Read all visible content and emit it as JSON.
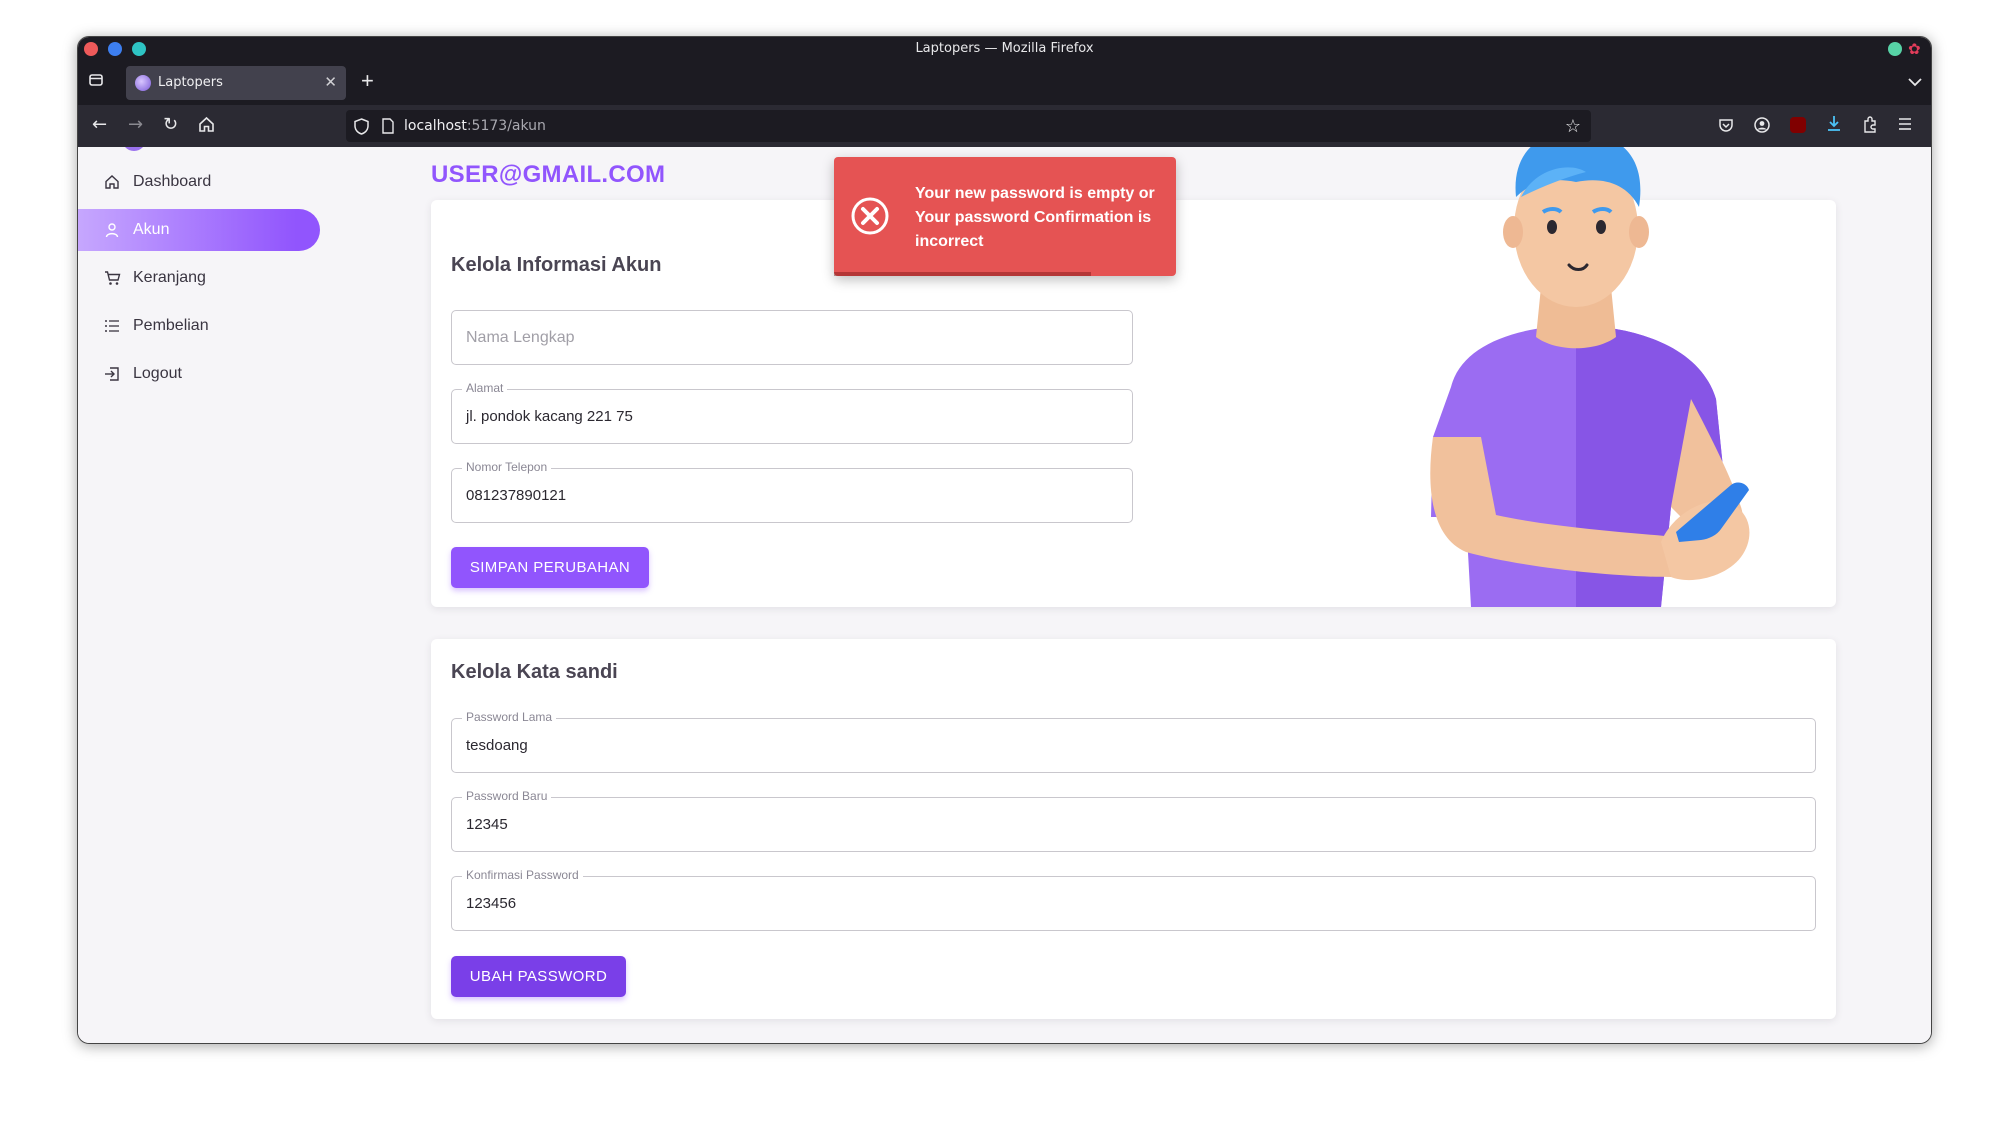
{
  "browser": {
    "window_title": "Laptopers — Mozilla Firefox",
    "tab_title": "Laptopers",
    "url_host": "localhost",
    "url_rest": ":5173/akun"
  },
  "sidebar": {
    "items": [
      {
        "label": "Dashboard",
        "icon": "home-icon"
      },
      {
        "label": "Akun",
        "icon": "user-icon",
        "active": true
      },
      {
        "label": "Keranjang",
        "icon": "cart-icon"
      },
      {
        "label": "Pembelian",
        "icon": "list-icon"
      },
      {
        "label": "Logout",
        "icon": "logout-icon"
      }
    ]
  },
  "header": {
    "email": "USER@GMAIL.COM"
  },
  "account_card": {
    "title": "Kelola Informasi Akun",
    "name_placeholder": "Nama Lengkap",
    "address_label": "Alamat",
    "address_value": "jl. pondok kacang 221 75",
    "phone_label": "Nomor Telepon",
    "phone_value": "081237890121",
    "save_button": "SIMPAN PERUBAHAN"
  },
  "password_card": {
    "title": "Kelola Kata sandi",
    "old_label": "Password Lama",
    "old_value": "tesdoang",
    "new_label": "Password Baru",
    "new_value": "12345",
    "confirm_label": "Konfirmasi Password",
    "confirm_value": "123456",
    "change_button": "UBAH PASSWORD"
  },
  "toast": {
    "message": "Your new password is empty or Your password Confirmation is incorrect",
    "progress": 0.75
  },
  "colors": {
    "accent": "#9155fd",
    "error": "#e55353"
  }
}
